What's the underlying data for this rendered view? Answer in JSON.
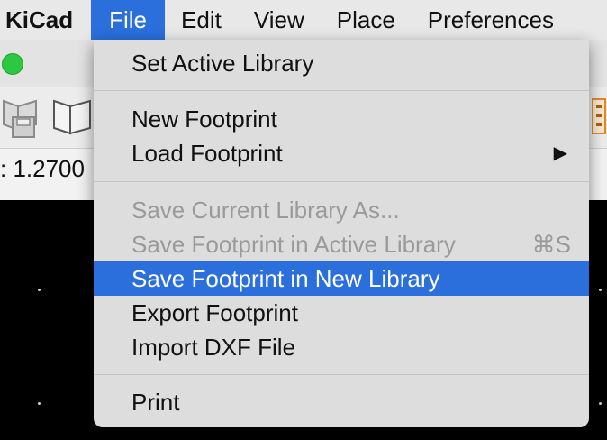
{
  "menubar": {
    "app": "KiCad",
    "items": [
      "File",
      "Edit",
      "View",
      "Place",
      "Preferences"
    ]
  },
  "status": {
    "zoom": ": 1.2700"
  },
  "file_menu": {
    "set_active_library": "Set Active Library",
    "new_footprint": "New Footprint",
    "load_footprint": "Load Footprint",
    "save_current_library_as": "Save Current Library As...",
    "save_footprint_active": "Save Footprint in Active Library",
    "save_footprint_active_shortcut": "⌘S",
    "save_footprint_new": "Save Footprint in New Library",
    "export_footprint": "Export Footprint",
    "import_dxf": "Import DXF File",
    "print": "Print",
    "submenu_arrow": "▶"
  },
  "colors": {
    "accent": "#2a6fdb",
    "menu_bg": "#dddddd",
    "disabled_text": "#9a9a9a"
  }
}
